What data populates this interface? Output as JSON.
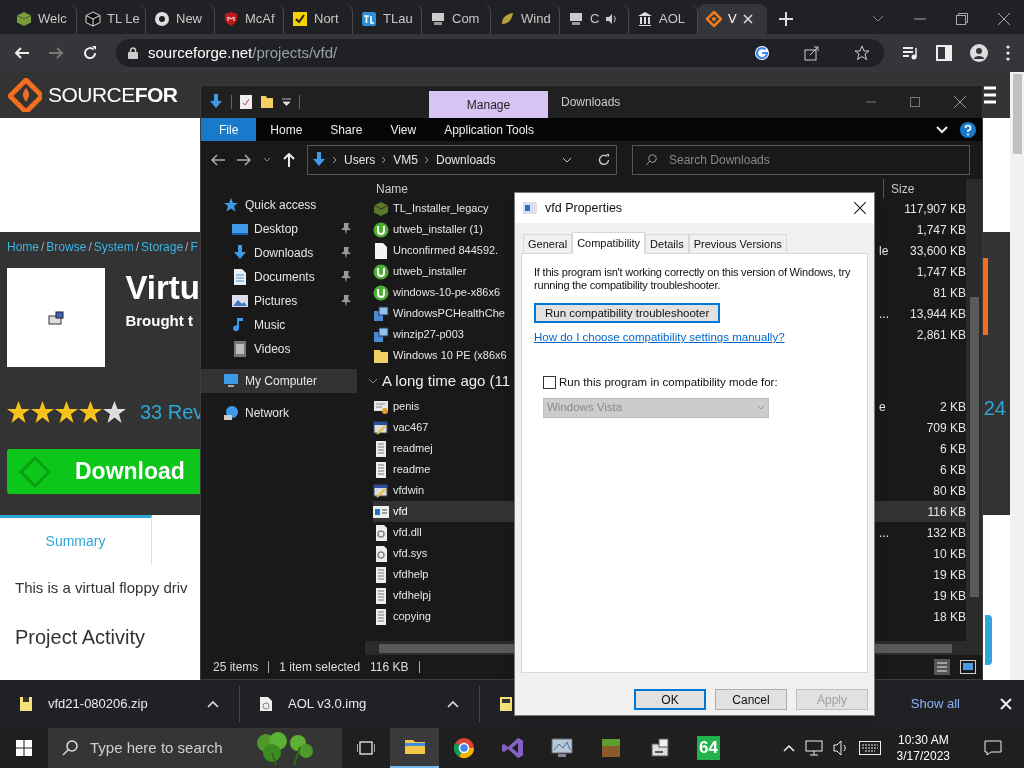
{
  "browser": {
    "tabs": [
      {
        "title": "Welc",
        "kind": "block",
        "selected": false
      },
      {
        "title": "TL Le",
        "kind": "cube",
        "selected": false
      },
      {
        "title": "New",
        "kind": "chrome",
        "selected": false
      },
      {
        "title": "McAf",
        "kind": "shield",
        "selected": false
      },
      {
        "title": "Nort",
        "kind": "check",
        "selected": false
      },
      {
        "title": "TLau",
        "kind": "tl",
        "selected": false
      },
      {
        "title": "Com",
        "kind": "computer",
        "selected": false
      },
      {
        "title": "Wind",
        "kind": "leaf",
        "selected": false
      },
      {
        "title": "C",
        "kind": "computer",
        "selected": false,
        "audio": true
      },
      {
        "title": "AOL",
        "kind": "bank",
        "selected": false
      },
      {
        "title": "V",
        "kind": "diamond",
        "selected": true
      }
    ],
    "url_host": "sourceforge.net",
    "url_path": "/projects/vfd/"
  },
  "website": {
    "logo_light": "SOURCE",
    "logo_bold": "FOR",
    "breadcrumb": [
      "Home",
      "Browse",
      "System",
      "Storage",
      "F"
    ],
    "breadcrumb_separator": "/",
    "title": "Virtu",
    "byline": "Brought t",
    "stars": 4,
    "reviews": "33 Rev",
    "download": "Download",
    "side_number": "24",
    "tabs": [
      {
        "label": "Summary",
        "selected": true
      }
    ],
    "description": "This is a virtual floppy driv",
    "section_heading": "Project Activity"
  },
  "explorer": {
    "context_tab": "Manage",
    "title": "Downloads",
    "ribbon_tabs": [
      {
        "label": "File",
        "selected": true
      },
      {
        "label": "Home",
        "selected": false
      },
      {
        "label": "Share",
        "selected": false
      },
      {
        "label": "View",
        "selected": false
      },
      {
        "label": "Application Tools",
        "selected": false
      }
    ],
    "path": [
      "Users",
      "VM5",
      "Downloads"
    ],
    "search": {
      "placeholder": "Search Downloads"
    },
    "nav": [
      {
        "label": "Quick access",
        "kind": "star",
        "selected": false,
        "pinned": false,
        "children": [
          {
            "label": "Desktop",
            "kind": "desktop",
            "selected": false,
            "pinned": true
          },
          {
            "label": "Downloads",
            "kind": "downloads",
            "selected": false,
            "pinned": true
          },
          {
            "label": "Documents",
            "kind": "documents",
            "selected": false,
            "pinned": true
          },
          {
            "label": "Pictures",
            "kind": "pictures",
            "selected": false,
            "pinned": true
          },
          {
            "label": "Music",
            "kind": "music",
            "selected": false,
            "pinned": false
          },
          {
            "label": "Videos",
            "kind": "videos",
            "selected": false,
            "pinned": false
          }
        ]
      },
      {
        "label": "My Computer",
        "kind": "computer",
        "selected": true,
        "pinned": false
      },
      {
        "label": "Network",
        "kind": "network",
        "selected": false,
        "pinned": false
      }
    ],
    "columns": [
      "Name",
      "Size"
    ],
    "groups": [
      {
        "rows": [
          {
            "name": "TL_Installer_legacy",
            "size": "117,907 KB",
            "kind": "package",
            "selected": false
          },
          {
            "name": "utweb_installer (1)",
            "size": "1,747 KB",
            "kind": "torrent",
            "selected": false
          },
          {
            "name": "Unconfirmed 844592.",
            "size": "33,600 KB",
            "kind": "blank",
            "selected": false,
            "type_fragment": "le"
          },
          {
            "name": "utweb_installer",
            "size": "1,747 KB",
            "kind": "torrent",
            "selected": false
          },
          {
            "name": "windows-10-pe-x86x6",
            "size": "81 KB",
            "kind": "torrent",
            "selected": false
          },
          {
            "name": "WindowsPCHealthChe",
            "size": "13,944 KB",
            "kind": "setup",
            "selected": false,
            "type_fragment": "..."
          },
          {
            "name": "winzip27-p003",
            "size": "2,861 KB",
            "kind": "setup",
            "selected": false
          },
          {
            "name": "Windows 10 PE (x86x6",
            "kind": "folder",
            "selected": false
          }
        ]
      },
      {
        "heading": "A long time ago (11",
        "expanded": true,
        "rows": [
          {
            "name": "penis",
            "size": "2 KB",
            "kind": "certificate",
            "selected": false,
            "type_fragment": "e"
          },
          {
            "name": "vac467",
            "size": "709 KB",
            "kind": "program",
            "selected": false
          },
          {
            "name": "readmej",
            "size": "6 KB",
            "kind": "text",
            "selected": false
          },
          {
            "name": "readme",
            "size": "6 KB",
            "kind": "text",
            "selected": false
          },
          {
            "name": "vfdwin",
            "size": "80 KB",
            "kind": "program",
            "selected": false
          },
          {
            "name": "vfd",
            "size": "116 KB",
            "kind": "window",
            "selected": true
          },
          {
            "name": "vfd.dll",
            "size": "132 KB",
            "kind": "system",
            "selected": false,
            "type_fragment": "..."
          },
          {
            "name": "vfd.sys",
            "size": "10 KB",
            "kind": "system",
            "selected": false
          },
          {
            "name": "vfdhelp",
            "size": "19 KB",
            "kind": "text",
            "selected": false
          },
          {
            "name": "vfdhelpj",
            "size": "19 KB",
            "kind": "text",
            "selected": false
          },
          {
            "name": "copying",
            "size": "18 KB",
            "kind": "text",
            "selected": false
          }
        ]
      }
    ],
    "status": {
      "count": "25 items",
      "selection": "1 item selected",
      "selection_size": "116 KB"
    }
  },
  "dialog": {
    "title": "vfd Properties",
    "tabs": [
      {
        "label": "General",
        "selected": false
      },
      {
        "label": "Compatibility",
        "selected": true
      },
      {
        "label": "Details",
        "selected": false
      },
      {
        "label": "Previous Versions",
        "selected": false
      }
    ],
    "intro": "If this program isn't working correctly on this version of Windows, try running the compatibility troubleshooter.",
    "troubleshooter_button": "Run compatibility troubleshooter",
    "help_link": "How do I choose compatibility settings manually?",
    "compat_checkbox": {
      "label": "Run this program in compatibility mode for:",
      "checked": false
    },
    "compat_select": {
      "value": "Windows Vista",
      "disabled": true
    },
    "buttons": [
      {
        "label": "OK",
        "default": true,
        "disabled": false
      },
      {
        "label": "Cancel",
        "default": false,
        "disabled": false
      },
      {
        "label": "Apply",
        "default": false,
        "disabled": true
      }
    ]
  },
  "downloads_bar": {
    "items": [
      {
        "name": "vfd21-080206.zip",
        "kind": "zip"
      },
      {
        "name": "AOL v3.0.img",
        "kind": "disc"
      },
      {
        "kind": "iso"
      }
    ],
    "show_all": "Show all"
  },
  "taskbar": {
    "search": {
      "placeholder": "Type here to search"
    },
    "apps": [
      {
        "kind": "explorer",
        "selected": true
      },
      {
        "kind": "chrome",
        "selected": false
      },
      {
        "kind": "studio",
        "selected": false
      },
      {
        "kind": "monitor",
        "selected": false
      },
      {
        "kind": "grass",
        "selected": false
      },
      {
        "kind": "drive",
        "selected": false
      },
      {
        "kind": "tile",
        "label": "64",
        "selected": false
      }
    ],
    "time": "10:30 AM",
    "date": "3/17/2023"
  }
}
